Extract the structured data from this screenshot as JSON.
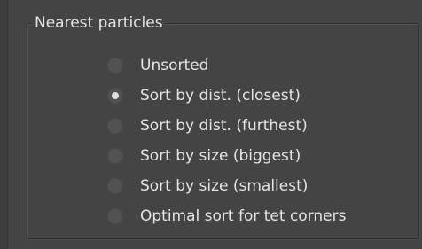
{
  "group": {
    "title": "Nearest particles"
  },
  "options": [
    {
      "label": "Unsorted",
      "selected": false
    },
    {
      "label": "Sort by dist. (closest)",
      "selected": true
    },
    {
      "label": "Sort by dist. (furthest)",
      "selected": false
    },
    {
      "label": "Sort by size (biggest)",
      "selected": false
    },
    {
      "label": "Sort by size (smallest)",
      "selected": false
    },
    {
      "label": "Optimal sort for tet corners",
      "selected": false
    }
  ],
  "colors": {
    "background": "#444444",
    "radio_unselected": "#525252",
    "radio_dot": "#dedede",
    "text": "#e4e4e4"
  },
  "icons": {
    "radio": "radio-button-icon"
  }
}
